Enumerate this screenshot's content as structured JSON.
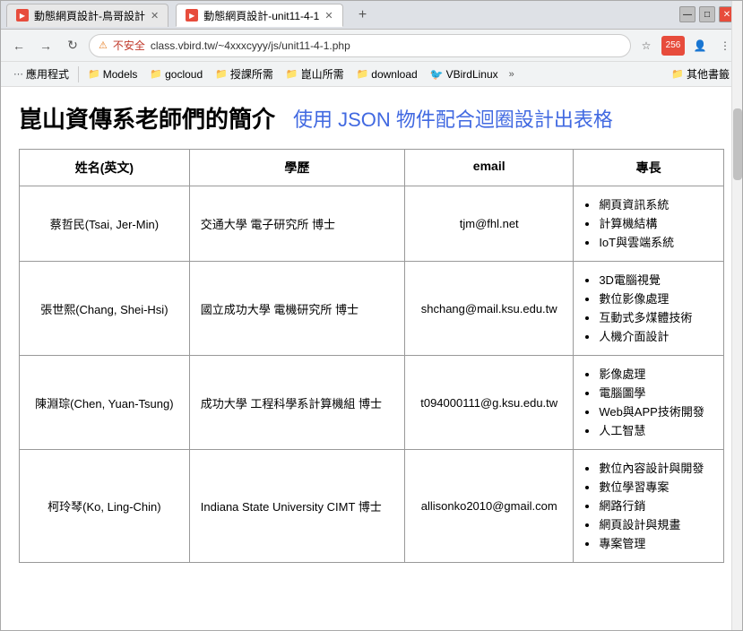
{
  "browser": {
    "title_bar": {
      "minimize": "—",
      "maximize": "□",
      "close": "✕"
    },
    "tabs": [
      {
        "id": "tab1",
        "label": "動態網頁設計-鳥哥設計",
        "active": false
      },
      {
        "id": "tab2",
        "label": "動態網頁設計-unit11-4-1",
        "active": true
      }
    ],
    "new_tab_label": "+",
    "address_bar": {
      "lock_indicator": "⚠",
      "url": "class.vbird.tw/~4xxxcyyy/js/unit11-4-1.php",
      "star_icon": "☆",
      "secure_text": "不安全"
    },
    "bookmarks": [
      {
        "id": "bk1",
        "label": "應用程式"
      },
      {
        "id": "bk2",
        "label": "Models"
      },
      {
        "id": "bk3",
        "label": "gocloud"
      },
      {
        "id": "bk4",
        "label": "授課所需"
      },
      {
        "id": "bk5",
        "label": "崑山所需"
      },
      {
        "id": "bk6",
        "label": "download"
      },
      {
        "id": "bk7",
        "label": "VBirdLinux"
      },
      {
        "id": "bk8",
        "label": "其他書籤"
      }
    ]
  },
  "page": {
    "title_main": "崑山資傳系老師們的簡介",
    "title_sub": "使用 JSON 物件配合迴圈設計出表格",
    "table": {
      "headers": [
        "姓名(英文)",
        "學歷",
        "email",
        "專長"
      ],
      "rows": [
        {
          "name": "蔡哲民(Tsai, Jer-Min)",
          "education": "交通大學 電子研究所 博士",
          "email": "tjm@fhl.net",
          "specialties": [
            "網頁資訊系統",
            "計算機結構",
            "IoT與雲端系統"
          ]
        },
        {
          "name": "張世熙(Chang, Shei-Hsi)",
          "education": "國立成功大學 電機研究所 博士",
          "email": "shchang@mail.ksu.edu.tw",
          "specialties": [
            "3D電腦視覺",
            "數位影像處理",
            "互動式多煤體技術",
            "人機介面設計"
          ]
        },
        {
          "name": "陳淵琮(Chen, Yuan-Tsung)",
          "education": "成功大學 工程科學系計算機組 博士",
          "email": "t094000111@g.ksu.edu.tw",
          "specialties": [
            "影像處理",
            "電腦圖學",
            "Web與APP技術開發",
            "人工智慧"
          ]
        },
        {
          "name": "柯玲琴(Ko, Ling-Chin)",
          "education": "Indiana State University CIMT 博士",
          "email": "allisonko2010@gmail.com",
          "specialties": [
            "數位內容設計與開發",
            "數位學習專案",
            "網路行銷",
            "網頁設計與規畫",
            "專案管理"
          ]
        }
      ]
    }
  }
}
